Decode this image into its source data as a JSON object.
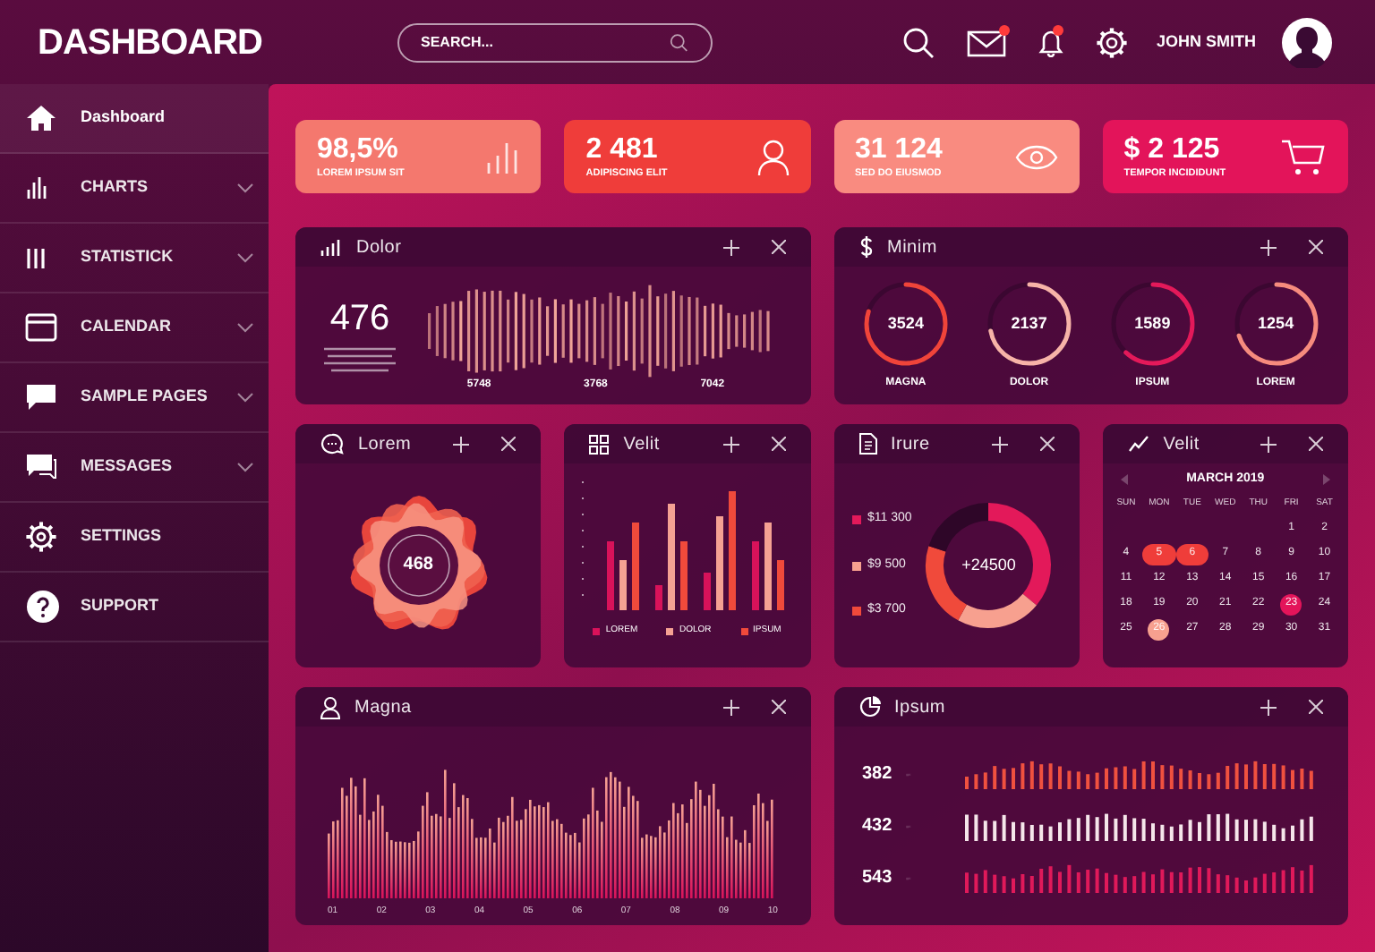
{
  "header": {
    "title": "DASHBOARD",
    "search": {
      "placeholder": "SEARCH..."
    },
    "mail_unread": true,
    "bell_unread": true,
    "user": "JOHN SMITH"
  },
  "sidebar": {
    "items": [
      {
        "label": "Dashboard",
        "selected": true,
        "expandable": false
      },
      {
        "label": "CHARTS",
        "selected": false,
        "expandable": true
      },
      {
        "label": "STATISTICK",
        "selected": false,
        "expandable": true
      },
      {
        "label": "CALENDAR",
        "selected": false,
        "expandable": true
      },
      {
        "label": "SAMPLE PAGES",
        "selected": false,
        "expandable": true
      },
      {
        "label": "MESSAGES",
        "selected": false,
        "expandable": true
      },
      {
        "label": "SETTINGS",
        "selected": false,
        "expandable": false
      },
      {
        "label": "SUPPORT",
        "selected": false,
        "expandable": false
      }
    ]
  },
  "stat_cards": [
    {
      "value": "98,5%",
      "label": "LOREM IPSUM SIT",
      "color": "#f4786e"
    },
    {
      "value": "2 481",
      "label": "ADIPISCING ELIT",
      "color": "#ef3d3a"
    },
    {
      "value": "31 124",
      "label": "SED DO EIUSMOD",
      "color": "#f98b80"
    },
    {
      "value": "$ 2 125",
      "label": "TEMPOR INCIDIDUNT",
      "color": "#e3145a"
    }
  ],
  "dolor_panel": {
    "title": "Dolor",
    "value": "476",
    "markers": [
      "5748",
      "3768",
      "7042"
    ]
  },
  "minim_panel": {
    "title": "Minim",
    "gauges": [
      {
        "value": "3524",
        "label": "MAGNA",
        "color": "#f0443a"
      },
      {
        "value": "2137",
        "label": "DOLOR",
        "color": "#f7b3a8"
      },
      {
        "value": "1589",
        "label": "IPSUM",
        "color": "#e3195a"
      },
      {
        "value": "1254",
        "label": "LOREM",
        "color": "#f68b7e"
      }
    ]
  },
  "lorem_panel": {
    "title": "Lorem",
    "value": "468"
  },
  "velit_chart_panel": {
    "title": "Velit",
    "legend": [
      {
        "label": "LOREM",
        "color": "#d8125a"
      },
      {
        "label": "DOLOR",
        "color": "#f5a193"
      },
      {
        "label": "IPSUM",
        "color": "#f04a3b"
      }
    ]
  },
  "irure_panel": {
    "title": "Irure",
    "center": "+24500",
    "legend": [
      {
        "label": "$11 300",
        "color": "#e3195a"
      },
      {
        "label": "$9 500",
        "color": "#f7a08f"
      },
      {
        "label": "$3 700",
        "color": "#f04a3b"
      }
    ]
  },
  "calendar_panel": {
    "title": "Velit",
    "month": "MARCH 2019",
    "weekdays": [
      "SUN",
      "MON",
      "TUE",
      "WED",
      "THU",
      "FRI",
      "SAT"
    ],
    "weeks": [
      [
        {
          "d": "1"
        },
        {
          "d": "2"
        }
      ],
      [
        {
          "d": "4"
        },
        {
          "d": "5",
          "color": "#ef3d3a"
        },
        {
          "d": "6",
          "color": "#ef3d3a"
        },
        {
          "d": "7"
        },
        {
          "d": "8"
        },
        {
          "d": "9"
        },
        {
          "d": "10"
        }
      ],
      [
        {
          "d": "11"
        },
        {
          "d": "12"
        },
        {
          "d": "13"
        },
        {
          "d": "14"
        },
        {
          "d": "15"
        },
        {
          "d": "16"
        },
        {
          "d": "17"
        }
      ],
      [
        {
          "d": "18"
        },
        {
          "d": "19"
        },
        {
          "d": "20"
        },
        {
          "d": "21"
        },
        {
          "d": "22"
        },
        {
          "d": "23",
          "color": "#e3145a"
        },
        {
          "d": "24"
        }
      ],
      [
        {
          "d": "25"
        },
        {
          "d": "26",
          "color": "#f7a08f"
        },
        {
          "d": "27"
        },
        {
          "d": "28"
        },
        {
          "d": "29"
        },
        {
          "d": "30"
        },
        {
          "d": "31"
        }
      ]
    ]
  },
  "magna_panel": {
    "title": "Magna",
    "x_labels": [
      "01",
      "02",
      "03",
      "04",
      "05",
      "06",
      "07",
      "08",
      "09",
      "10"
    ]
  },
  "ipsum_panel": {
    "title": "Ipsum",
    "rows": [
      {
        "value": "382",
        "color": "#f0513f"
      },
      {
        "value": "432",
        "color": "#f5e6ea"
      },
      {
        "value": "543",
        "color": "#e0195a"
      }
    ]
  }
}
